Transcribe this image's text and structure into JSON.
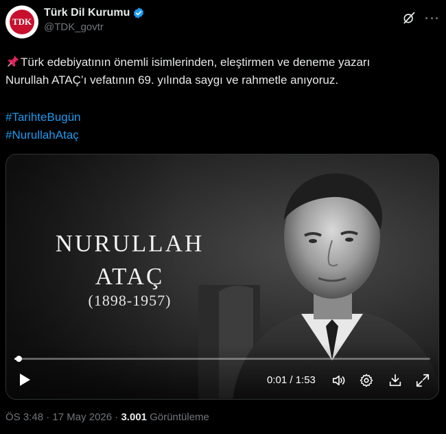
{
  "account": {
    "display_name": "Türk Dil Kurumu",
    "handle": "@TDK_govtr",
    "verified": true,
    "avatar_mark": "TDK",
    "brand_color": "#c8102e"
  },
  "tweet": {
    "line1": "Türk edebiyatının önemli isimlerinden, eleştirmen ve deneme yazarı",
    "line2": "Nurullah ATAÇ’ı vefatının 69. yılında saygı ve rahmetle anıyoruz.",
    "hashtags": [
      "#TarihteBugün",
      "#NurullahAtaç"
    ],
    "hashtag_color": "#1d9bf0"
  },
  "video": {
    "title_line1": "NURULLAH",
    "title_line2": "ATAÇ",
    "dates": "(1898-1957)",
    "time_display": "0:01 / 1:53",
    "progress": 0.01,
    "controls": [
      "play-icon",
      "volume-icon",
      "settings-gear-icon",
      "download-icon",
      "fullscreen-icon"
    ]
  },
  "footer": {
    "time": "ÖS 3:48",
    "separator": "·",
    "date": "17 May 2026",
    "views_count": "3.001",
    "views_label": "Görüntüleme"
  }
}
